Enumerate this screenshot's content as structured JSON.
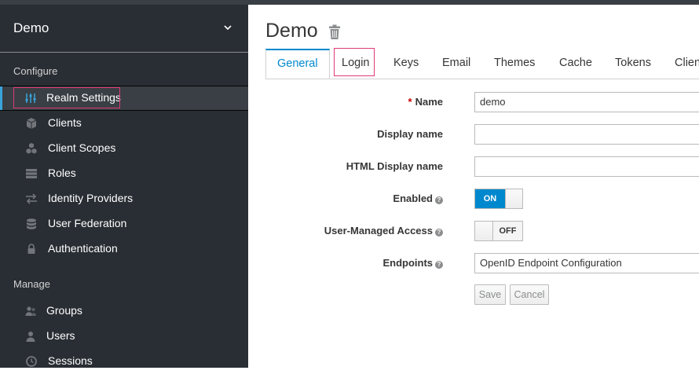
{
  "sidebar": {
    "realm_name": "Demo",
    "configure_heading": "Configure",
    "manage_heading": "Manage",
    "configure_items": [
      {
        "label": "Realm Settings",
        "icon": "sliders-icon",
        "active": true
      },
      {
        "label": "Clients",
        "icon": "cube-icon"
      },
      {
        "label": "Client Scopes",
        "icon": "cubes-icon"
      },
      {
        "label": "Roles",
        "icon": "list-icon"
      },
      {
        "label": "Identity Providers",
        "icon": "exchange-icon"
      },
      {
        "label": "User Federation",
        "icon": "database-icon"
      },
      {
        "label": "Authentication",
        "icon": "lock-icon"
      }
    ],
    "manage_items": [
      {
        "label": "Groups",
        "icon": "users-group-icon"
      },
      {
        "label": "Users",
        "icon": "user-icon"
      },
      {
        "label": "Sessions",
        "icon": "clock-icon"
      }
    ]
  },
  "main": {
    "title": "Demo",
    "tabs": [
      "General",
      "Login",
      "Keys",
      "Email",
      "Themes",
      "Cache",
      "Tokens",
      "Clien"
    ],
    "active_tab": "General",
    "form": {
      "name_label": "Name",
      "name_required_mark": "*",
      "name_value": "demo",
      "display_name_label": "Display name",
      "display_name_value": "",
      "html_display_name_label": "HTML Display name",
      "html_display_name_value": "",
      "enabled_label": "Enabled",
      "enabled_value": "ON",
      "user_managed_access_label": "User-Managed Access",
      "user_managed_access_value": "OFF",
      "endpoints_label": "Endpoints",
      "endpoints_value": "OpenID Endpoint Configuration",
      "help_glyph": "?",
      "save_label": "Save",
      "cancel_label": "Cancel"
    }
  },
  "colors": {
    "sidebar_bg": "#292e34",
    "accent": "#0088ce",
    "highlight": "#e03a78"
  }
}
